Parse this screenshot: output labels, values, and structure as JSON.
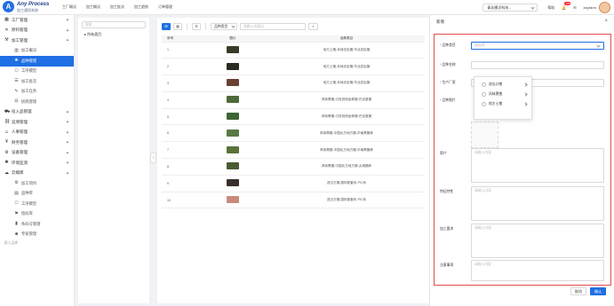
{
  "brand": {
    "title": "Any Process",
    "subtitle": "加工通用系统"
  },
  "topnav": [
    "工厂概况",
    "加工概况",
    "加工批次",
    "加工趋势",
    "订单管理"
  ],
  "topright": {
    "org": "青岛模识科技...",
    "help": "帮助",
    "notify_count": "179",
    "user": "anyfarm"
  },
  "sidebar": {
    "items": [
      {
        "label": "工厂管理",
        "icon": "factory-icon",
        "arrow": true
      },
      {
        "label": "原料管理",
        "icon": "cross-icon",
        "arrow": true
      },
      {
        "label": "加工管理",
        "icon": "hammer-icon",
        "arrow": true
      },
      {
        "label": "加工概况",
        "sub": true,
        "icon": "chart-icon"
      },
      {
        "label": "品种管理",
        "sub": true,
        "icon": "leaf-icon",
        "active": true
      },
      {
        "label": "工序模型",
        "sub": true,
        "icon": "model-icon"
      },
      {
        "label": "加工批次",
        "sub": true,
        "icon": "batch-icon"
      },
      {
        "label": "加工任务",
        "sub": true,
        "icon": "task-icon"
      },
      {
        "label": "损耗管理",
        "sub": true,
        "icon": "loss-icon"
      },
      {
        "label": "投入品管理",
        "icon": "input-icon",
        "arrow": true
      },
      {
        "label": "追溯管理",
        "icon": "trace-icon",
        "arrow": true
      },
      {
        "label": "人事管理",
        "icon": "person-icon",
        "arrow": true
      },
      {
        "label": "财务管理",
        "icon": "money-icon",
        "arrow": true
      },
      {
        "label": "设备管理",
        "icon": "device-icon",
        "arrow": true
      },
      {
        "label": "环境监测",
        "icon": "env-icon",
        "arrow": true
      },
      {
        "label": "云端库",
        "icon": "cloud-icon",
        "arrow": true
      },
      {
        "label": "加工项目",
        "sub": true,
        "icon": "project-icon"
      },
      {
        "label": "品种库",
        "sub": true,
        "icon": "library-icon"
      },
      {
        "label": "工序模型",
        "sub": true,
        "icon": "model-icon"
      },
      {
        "label": "指标库",
        "sub": true,
        "icon": "flag-icon"
      },
      {
        "label": "条码号管理",
        "sub": true,
        "icon": "barcode-icon"
      },
      {
        "label": "专家管理",
        "sub": true,
        "icon": "expert-icon"
      }
    ],
    "section": "投入品库"
  },
  "tree": {
    "search_placeholder": "搜索",
    "root": "所有类目"
  },
  "toolbar": {
    "add": "⊞",
    "grid": "▦",
    "settings": "⚙",
    "select": "品种类目",
    "input_placeholder": "请输入关键词"
  },
  "table": {
    "headers": [
      "序号",
      "图片",
      "品种类目"
    ],
    "rows": [
      {
        "num": "1",
        "thumb": "#3a3a2a",
        "cat": "地方土猪-本地农民猪-华北农民猪"
      },
      {
        "num": "2",
        "thumb": "#2a2a22",
        "cat": "地方土猪-本地农民猪-华北农民猪"
      },
      {
        "num": "3",
        "thumb": "#6a4030",
        "cat": "地方土猪-本地农民猪-华北农民猪"
      },
      {
        "num": "4",
        "thumb": "#4d6a3a",
        "cat": "风味黑猪-引进其他品种猪-巴克夏猪"
      },
      {
        "num": "5",
        "thumb": "#3e6432",
        "cat": "风味黑猪-引进其他品种猪-巴克夏猪"
      },
      {
        "num": "6",
        "thumb": "#587a42",
        "cat": "风味黑猪-中国北方地方猪-华南黑猪种"
      },
      {
        "num": "7",
        "thumb": "#5a7238",
        "cat": "风味黑猪-中国北方地方猪-华南黑猪种"
      },
      {
        "num": "8",
        "thumb": "#4a5a30",
        "cat": "风味黑猪-中国北方地方猪-太湖猪种"
      },
      {
        "num": "9",
        "thumb": "#3a2e2a",
        "cat": "进出方猪-国际配套系-PIC系"
      },
      {
        "num": "10",
        "thumb": "#c98a7a",
        "cat": "进出方猪-国际配套系-PIC系"
      }
    ]
  },
  "drawer": {
    "title": "新增",
    "fields": {
      "category": {
        "label": "品种类目",
        "placeholder": "请选择"
      },
      "name": {
        "label": "品种名称",
        "placeholder": ""
      },
      "maker": {
        "label": "生产厂家",
        "placeholder": ""
      },
      "image": {
        "label": "品种图片"
      },
      "intro": {
        "label": "简介",
        "placeholder": "请输入内容"
      },
      "feature": {
        "label": "特征特性",
        "placeholder": "请输入内容"
      },
      "process": {
        "label": "加工要求",
        "placeholder": "请输入内容"
      },
      "notes": {
        "label": "注意事项",
        "placeholder": "请输入内容"
      }
    },
    "dropdown": [
      "进出口猪",
      "风味黑猪",
      "地方土猪"
    ],
    "cancel": "取消",
    "confirm": "确认"
  }
}
